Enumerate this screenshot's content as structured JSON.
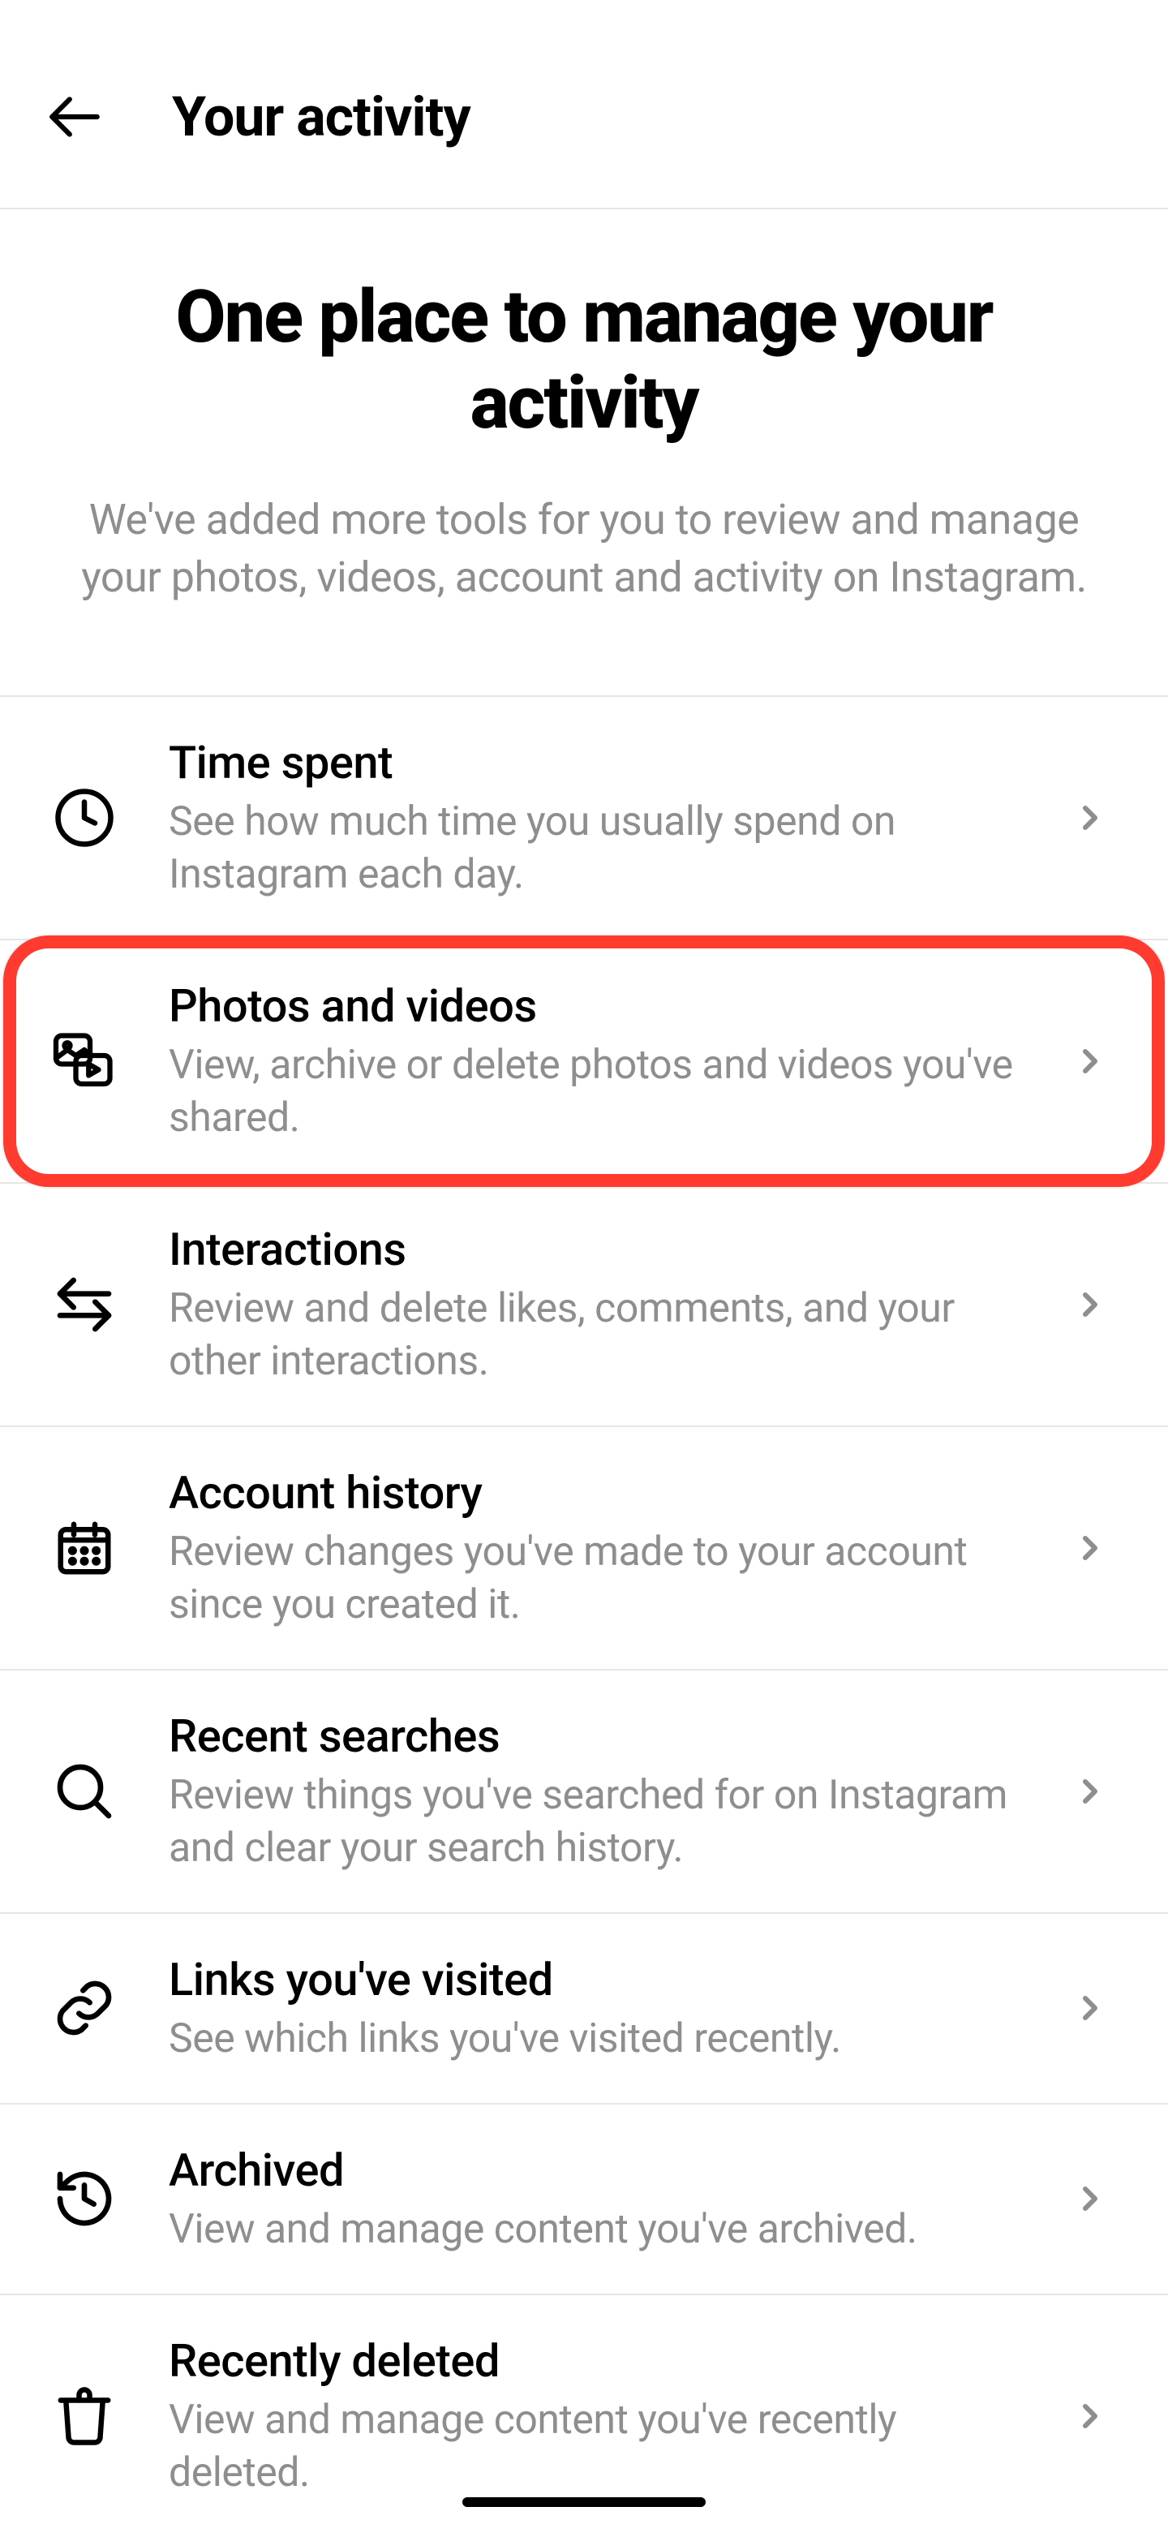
{
  "header": {
    "title": "Your activity"
  },
  "intro": {
    "heading": "One place to manage your activity",
    "subheading": "We've added more tools for you to review and manage your photos, videos, account and activity on Instagram."
  },
  "items": [
    {
      "title": "Time spent",
      "description": "See how much time you usually spend on Instagram each day."
    },
    {
      "title": "Photos and videos",
      "description": "View, archive or delete photos and videos you've shared."
    },
    {
      "title": "Interactions",
      "description": "Review and delete likes, comments, and your other interactions."
    },
    {
      "title": "Account history",
      "description": "Review changes you've made to your account since you created it."
    },
    {
      "title": "Recent searches",
      "description": "Review things you've searched for on Instagram and clear your search history."
    },
    {
      "title": "Links you've visited",
      "description": "See which links you've visited recently."
    },
    {
      "title": "Archived",
      "description": "View and manage content you've archived."
    },
    {
      "title": "Recently deleted",
      "description": "View and manage content you've recently deleted."
    }
  ]
}
